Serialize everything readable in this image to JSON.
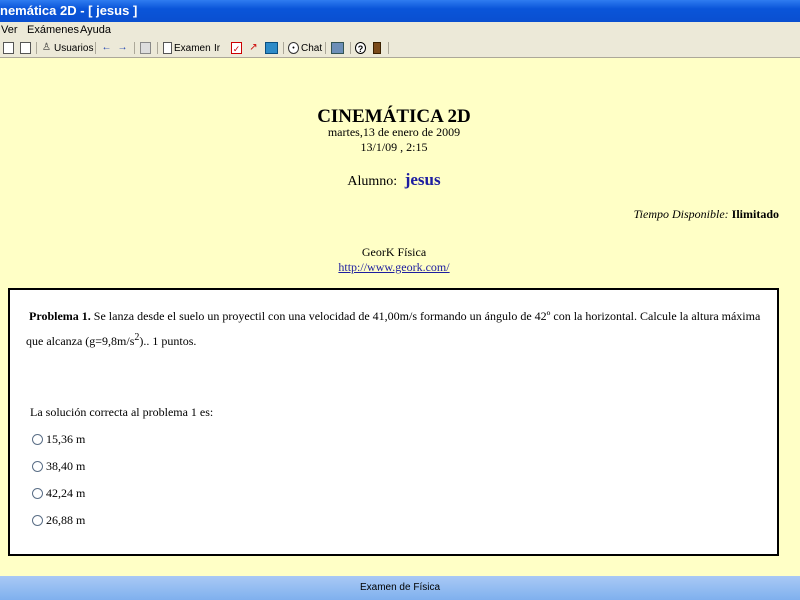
{
  "window": {
    "title": "nemática 2D - [ jesus ]"
  },
  "menu": [
    "Ver",
    "Exámenes",
    "Ayuda"
  ],
  "toolbar": {
    "usuarios_label": "Usuarios",
    "examen_label": "Examen",
    "ir_label": "Ir",
    "chat_label": "Chat"
  },
  "header": {
    "title": "CINEMÁTICA 2D",
    "date_long": "martes,13 de enero de 2009",
    "date_short": "13/1/09 , 2:15",
    "alumno_label": "Alumno:",
    "alumno_name": "jesus",
    "tiempo_label": "Tiempo Disponible:",
    "tiempo_value": "Ilimitado",
    "org": "GeorK Física",
    "url": "http://www.geork.com/"
  },
  "problem": {
    "label": "Problema 1.",
    "text_a": "Se lanza desde el suelo un proyectil con una velocidad de 41,00m/s formando un ángulo de 42º con la horizontal. Calcule la altura máxima que alcanza (g=9,8m/s",
    "text_sup": "2",
    "text_b": ").. 1 puntos.",
    "question": "La solución correcta al problema 1 es:",
    "options": [
      "15,36 m",
      "38,40 m",
      "42,24 m",
      "26,88 m"
    ]
  },
  "status": {
    "text": "Examen de Física"
  }
}
